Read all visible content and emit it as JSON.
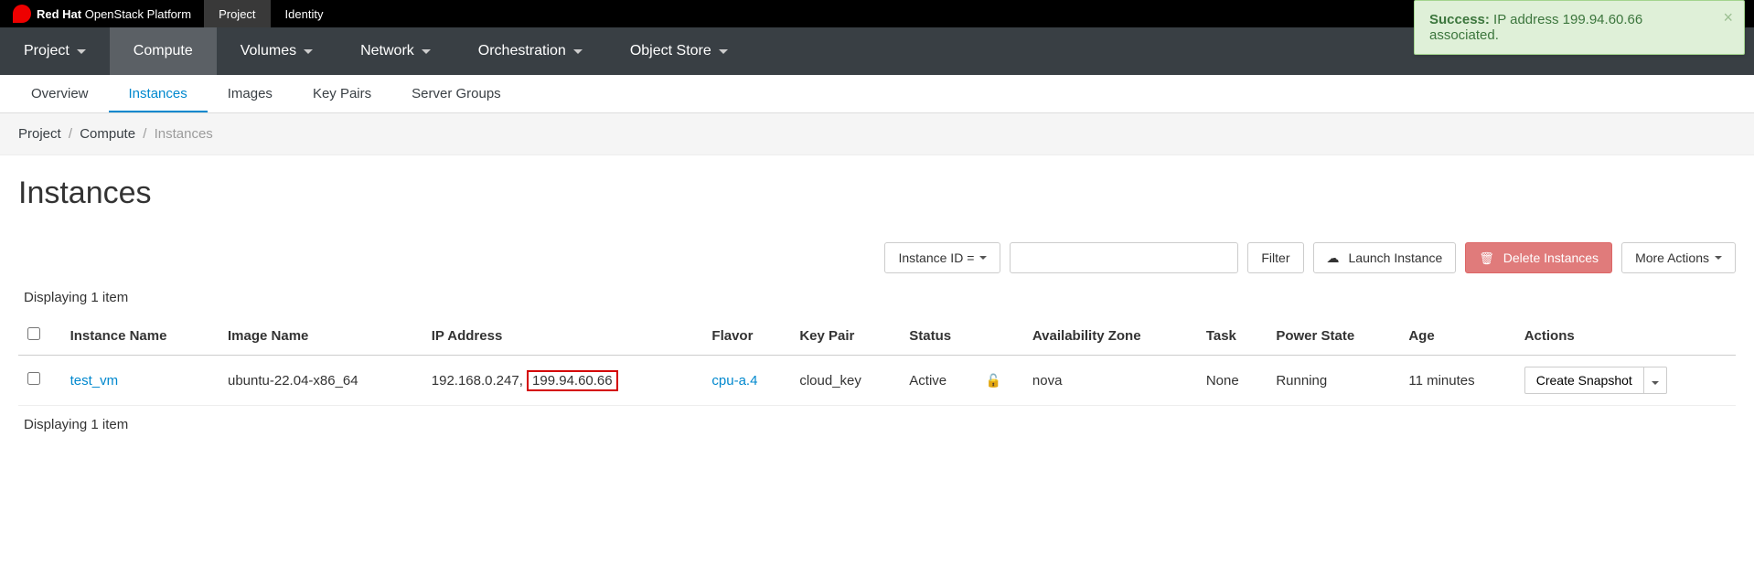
{
  "brand": {
    "company": "Red Hat",
    "product": " OpenStack Platform"
  },
  "top_tabs": {
    "project": "Project",
    "identity": "Identity"
  },
  "nav": {
    "project": "Project",
    "compute": "Compute",
    "volumes": "Volumes",
    "network": "Network",
    "orchestration": "Orchestration",
    "object_store": "Object Store"
  },
  "subnav": {
    "overview": "Overview",
    "instances": "Instances",
    "images": "Images",
    "key_pairs": "Key Pairs",
    "server_groups": "Server Groups"
  },
  "crumbs": {
    "a": "Project",
    "b": "Compute",
    "c": "Instances"
  },
  "page_title": "Instances",
  "toolbar": {
    "filter_select": "Instance ID =",
    "filter_btn": "Filter",
    "launch_btn": "Launch Instance",
    "delete_btn": "Delete Instances",
    "more_btn": "More Actions"
  },
  "displaying_top": "Displaying 1 item",
  "displaying_bottom": "Displaying 1 item",
  "cols": {
    "name": "Instance Name",
    "image": "Image Name",
    "ip": "IP Address",
    "flavor": "Flavor",
    "keypair": "Key Pair",
    "status": "Status",
    "az": "Availability Zone",
    "task": "Task",
    "power": "Power State",
    "age": "Age",
    "actions": "Actions"
  },
  "row": {
    "name": "test_vm",
    "image": "ubuntu-22.04-x86_64",
    "ip1": "192.168.0.247,",
    "ip2": "199.94.60.66",
    "flavor": "cpu-a.4",
    "keypair": "cloud_key",
    "status": "Active",
    "az": "nova",
    "task": "None",
    "power": "Running",
    "age": "11 minutes",
    "action_btn": "Create Snapshot"
  },
  "toast": {
    "prefix": "Success:",
    "msg": " IP address 199.94.60.66 associated."
  }
}
